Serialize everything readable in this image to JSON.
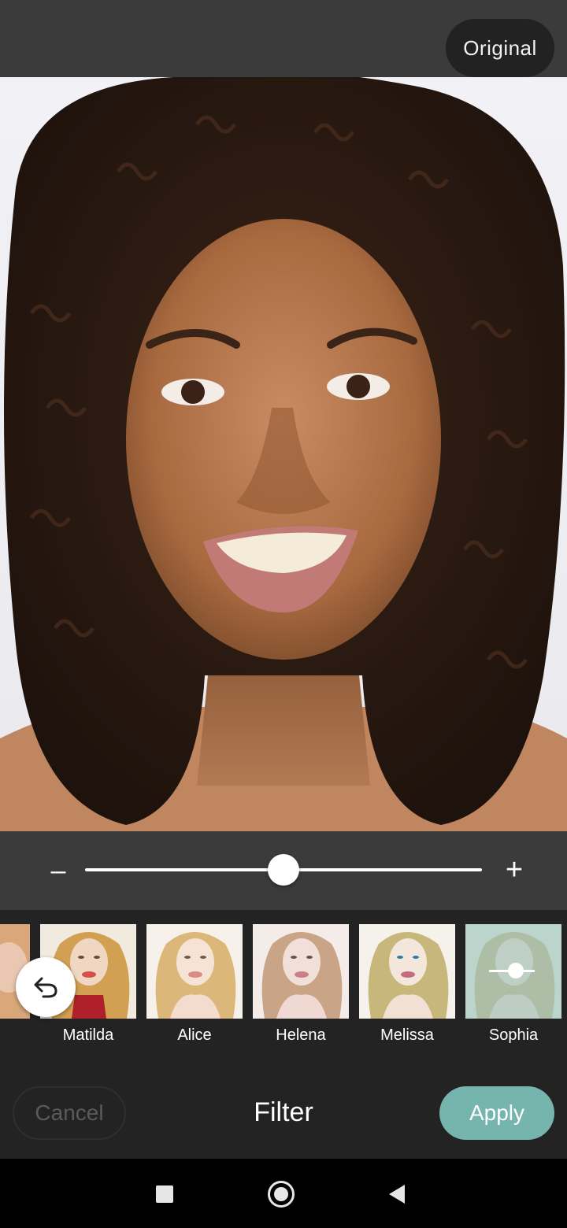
{
  "top_bar": {
    "original_label": "Original"
  },
  "photo": {
    "subject_icon": "portrait-photo"
  },
  "intensity_slider": {
    "minus_symbol": "–",
    "plus_symbol": "+",
    "value": 0.5
  },
  "filters": {
    "items": [
      {
        "label": "",
        "partial": true
      },
      {
        "label": "Matilda"
      },
      {
        "label": "Alice"
      },
      {
        "label": "Helena"
      },
      {
        "label": "Melissa"
      },
      {
        "label": "Sophia",
        "selected": true
      }
    ],
    "undo_icon": "undo-icon"
  },
  "action_bar": {
    "cancel_label": "Cancel",
    "title": "Filter",
    "apply_label": "Apply"
  },
  "colors": {
    "accent": "#76b5ad",
    "bar": "#3b3b3b",
    "panel": "#232323"
  }
}
